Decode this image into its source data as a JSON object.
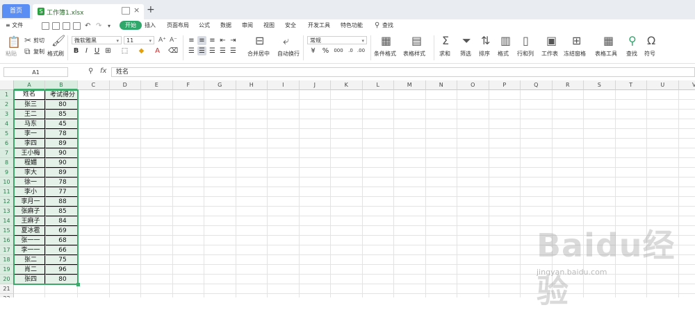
{
  "tabs": {
    "home": "首页",
    "file": "工作簿1.xlsx",
    "add": "+"
  },
  "menu": {
    "file": "≡ 文件",
    "items": [
      "开始",
      "插入",
      "页面布局",
      "公式",
      "数据",
      "审阅",
      "视图",
      "安全",
      "开发工具",
      "特色功能"
    ],
    "search": "查找",
    "active_index": 0
  },
  "ribbon": {
    "paste": "粘贴",
    "cut": "剪切",
    "copy": "复制",
    "format_painter": "格式刷",
    "font_name": "微软雅黑",
    "font_size": "11",
    "merge": "合并居中",
    "wrap": "自动换行",
    "number_format": "常规",
    "cond_format": "条件格式",
    "table_style": "表格样式",
    "sum": "求和",
    "filter": "筛选",
    "sort": "排序",
    "format": "格式",
    "rowcol": "行和列",
    "sheet": "工作表",
    "freeze": "冻结窗格",
    "table_tools": "表格工具",
    "find": "查找",
    "symbol": "符号",
    "bold": "B",
    "italic": "I",
    "underline": "U",
    "percent": "%",
    "thousands": "000"
  },
  "formula_bar": {
    "cell_ref": "A1",
    "fx": "fx",
    "content": "姓名"
  },
  "columns": [
    "A",
    "B",
    "C",
    "D",
    "E",
    "F",
    "G",
    "H",
    "I",
    "J",
    "K",
    "L",
    "M",
    "N",
    "O",
    "P",
    "Q",
    "R",
    "S",
    "T",
    "U",
    "V"
  ],
  "row_numbers": [
    "1",
    "2",
    "3",
    "4",
    "5",
    "6",
    "7",
    "8",
    "9",
    "10",
    "11",
    "12",
    "13",
    "14",
    "15",
    "16",
    "17",
    "18",
    "19",
    "20",
    "21",
    "22"
  ],
  "table": {
    "headers": [
      "姓名",
      "考试得分"
    ],
    "rows": [
      [
        "张三",
        "80"
      ],
      [
        "王二",
        "85"
      ],
      [
        "马东",
        "45"
      ],
      [
        "李一",
        "78"
      ],
      [
        "李四",
        "89"
      ],
      [
        "王小梅",
        "90"
      ],
      [
        "程媚",
        "90"
      ],
      [
        "李大",
        "89"
      ],
      [
        "徐一",
        "78"
      ],
      [
        "李小",
        "77"
      ],
      [
        "李月一",
        "88"
      ],
      [
        "张麻子",
        "85"
      ],
      [
        "王麻子",
        "84"
      ],
      [
        "夏冰雹",
        "69"
      ],
      [
        "张一一",
        "68"
      ],
      [
        "李一一",
        "66"
      ],
      [
        "张二",
        "75"
      ],
      [
        "肖二",
        "96"
      ],
      [
        "张四",
        "80"
      ]
    ]
  },
  "watermark": {
    "brand": "Baidu经验",
    "url": "jingyan.baidu.com"
  },
  "colors": {
    "accent": "#2fa66a",
    "home_tab": "#5b8ef5",
    "selection": "#3ea86a"
  }
}
